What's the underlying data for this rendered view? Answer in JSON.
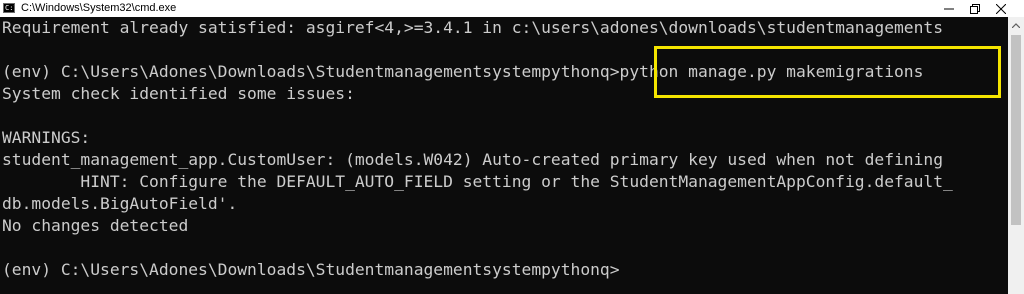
{
  "window": {
    "title": "C:\\Windows\\System32\\cmd.exe",
    "icon": "cmd-icon"
  },
  "caption_buttons": {
    "minimize": "minimize-icon",
    "maximize": "restore-icon",
    "close": "close-icon"
  },
  "console": {
    "lines": [
      "Requirement already satisfied: asgiref<4,>=3.4.1 in c:\\users\\adones\\downloads\\studentmanagements",
      "",
      "(env) C:\\Users\\Adones\\Downloads\\Studentmanagementsystempythonq>python manage.py makemigrations",
      "System check identified some issues:",
      "",
      "WARNINGS:",
      "student_management_app.CustomUser: (models.W042) Auto-created primary key used when not defining",
      "        HINT: Configure the DEFAULT_AUTO_FIELD setting or the StudentManagementAppConfig.default_",
      "db.models.BigAutoField'.",
      "No changes detected",
      "",
      "(env) C:\\Users\\Adones\\Downloads\\Studentmanagementsystempythonq>"
    ]
  },
  "highlight": {
    "color": "#f5e500",
    "target": "python manage.py makemigrations"
  },
  "colors": {
    "background": "#0c0c0c",
    "text": "#cccccc",
    "titlebar": "#ffffff"
  }
}
